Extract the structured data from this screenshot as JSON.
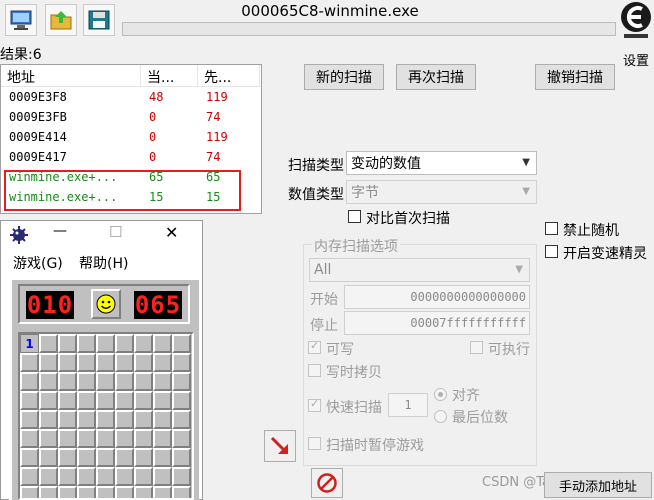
{
  "window": {
    "title": "000065C8-winmine.exe",
    "settings_label": "设置"
  },
  "results_label": "结果:6",
  "list": {
    "headers": [
      "地址",
      "当...",
      "先..."
    ],
    "rows": [
      {
        "addr": "0009E3F8",
        "cur": "48",
        "prev": "119",
        "style": "red"
      },
      {
        "addr": "0009E3FB",
        "cur": "0",
        "prev": "74",
        "style": "red"
      },
      {
        "addr": "0009E414",
        "cur": "0",
        "prev": "119",
        "style": "red"
      },
      {
        "addr": "0009E417",
        "cur": "0",
        "prev": "74",
        "style": "red"
      },
      {
        "addr": "winmine.exe+...",
        "cur": "65",
        "prev": "65",
        "style": "green"
      },
      {
        "addr": "winmine.exe+...",
        "cur": "15",
        "prev": "15",
        "style": "green"
      }
    ]
  },
  "buttons": {
    "new_scan": "新的扫描",
    "next_scan": "再次扫描",
    "undo_scan": "撤销扫描",
    "add_manual": "手动添加地址"
  },
  "scan": {
    "scan_type_label": "扫描类型",
    "scan_type_value": "变动的数值",
    "value_type_label": "数值类型",
    "value_type_value": "字节",
    "compare_first": "对比首次扫描"
  },
  "memory": {
    "group_title": "内存扫描选项",
    "region": "All",
    "start_label": "开始",
    "start_value": "0000000000000000",
    "stop_label": "停止",
    "stop_value": "00007fffffffffff",
    "writable": "可写",
    "executable": "可执行",
    "copy_on_write": "写时拷贝",
    "fast_scan": "快速扫描",
    "fast_scan_value": "1",
    "align": "对齐",
    "last_digits": "最后位数",
    "pause_game": "扫描时暂停游戏"
  },
  "options": {
    "no_random": "禁止随机",
    "speedhack": "开启变速精灵"
  },
  "minesweeper": {
    "menu_game": "游戏(G)",
    "menu_help": "帮助(H)",
    "minimize_glyph": "—",
    "maximize_glyph": "☐",
    "close_glyph": "✕",
    "mine_counter": "010",
    "timer": "065",
    "opened_cell_value": "1"
  },
  "watermark": "CSDN @Ta"
}
